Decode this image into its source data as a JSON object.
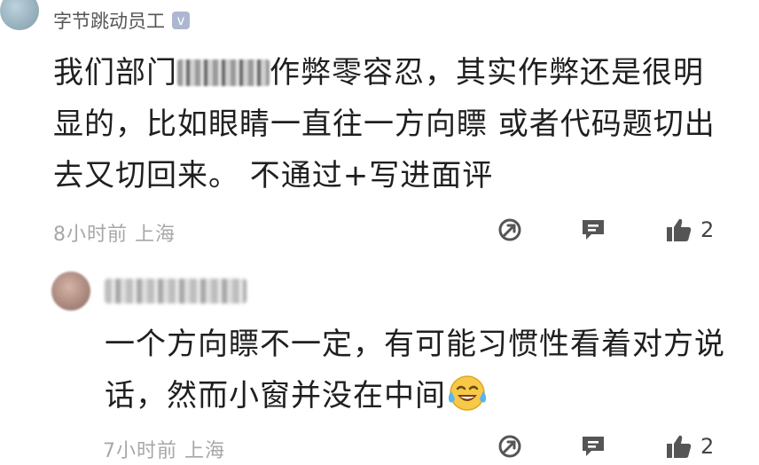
{
  "comment1": {
    "username": "字节跳动员工",
    "verified_icon": "v",
    "text_before_blur": "我们部门",
    "text_after_blur": "作弊零容忍，其实作弊还是很明显的，比如眼睛一直往一方向瞟 或者代码题切出去又切回来。 不通过+写进面评",
    "time": "8小时前",
    "location": "上海",
    "likes": "2"
  },
  "reply1": {
    "text": "一个方向瞟不一定，有可能习惯性看着对方说话，然而小窗并没在中间",
    "emoji": "tears-of-joy-emoji",
    "time": "7小时前",
    "location": "上海",
    "likes": "2"
  },
  "colors": {
    "meta_gray": "#a7a7a7",
    "icon_gray": "#555555",
    "verified_bg": "#aeb7d1"
  },
  "icons": [
    "share-icon",
    "comment-icon",
    "like-icon"
  ]
}
